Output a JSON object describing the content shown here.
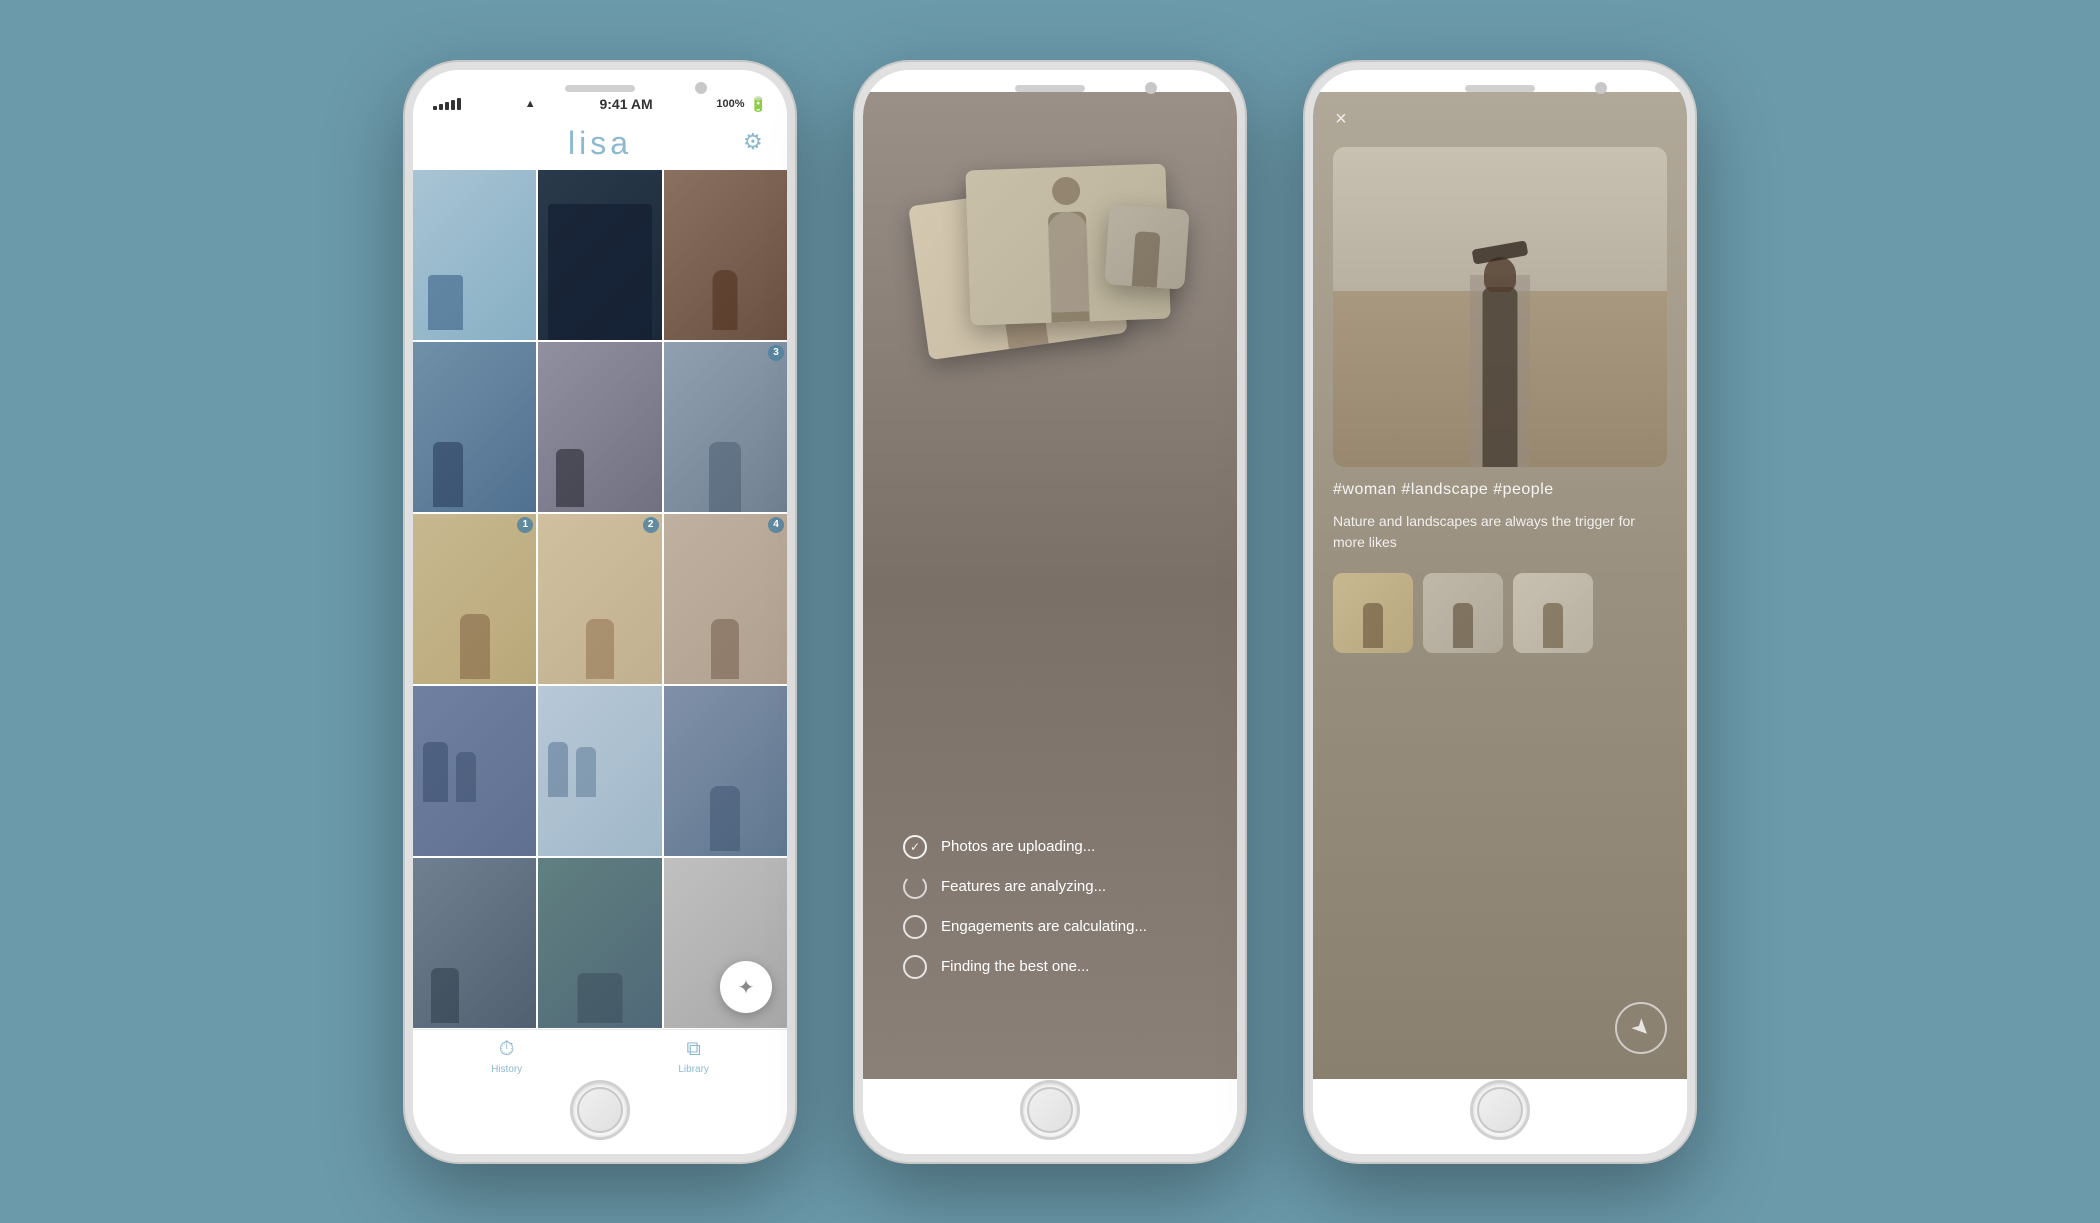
{
  "background": "#6b9aab",
  "phones": [
    {
      "id": "phone1",
      "status_bar": {
        "signal": "●●●●●",
        "wifi": "WiFi",
        "time": "9:41 AM",
        "battery": "100%"
      },
      "header": {
        "title": "lisa",
        "settings_icon": "⚙"
      },
      "grid": {
        "cells": [
          {
            "color_class": "pc1",
            "badge": null
          },
          {
            "color_class": "pc2",
            "badge": null
          },
          {
            "color_class": "pc3",
            "badge": null
          },
          {
            "color_class": "pc4",
            "badge": null
          },
          {
            "color_class": "pc5",
            "badge": null
          },
          {
            "color_class": "pc6",
            "badge": "3"
          },
          {
            "color_class": "pc7",
            "badge": "1"
          },
          {
            "color_class": "pc8",
            "badge": "2"
          },
          {
            "color_class": "pc9",
            "badge": "4"
          },
          {
            "color_class": "pc10",
            "badge": null
          },
          {
            "color_class": "pc11",
            "badge": null
          },
          {
            "color_class": "pc12",
            "badge": null
          },
          {
            "color_class": "pc13",
            "badge": null
          },
          {
            "color_class": "pc14",
            "badge": null
          },
          {
            "color_class": "pc15",
            "badge": null
          }
        ]
      },
      "magic_wand": "✦",
      "nav": {
        "items": [
          {
            "icon": "⏱",
            "label": "History"
          },
          {
            "icon": "⧉",
            "label": "Library"
          }
        ]
      }
    },
    {
      "id": "phone2",
      "status_items": [
        {
          "text": "Photos are uploading...",
          "done": true
        },
        {
          "text": "Features are analyzing...",
          "done": false
        },
        {
          "text": "Engagements are calculating...",
          "done": false
        },
        {
          "text": "Finding the best one...",
          "done": false
        }
      ]
    },
    {
      "id": "phone3",
      "close_icon": "×",
      "hashtags": "#woman #landscape #people",
      "caption": "Nature and landscapes are always the trigger for more likes",
      "share_icon": "➤",
      "thumbnails": [
        "thumb1",
        "thumb2",
        "thumb3"
      ]
    }
  ]
}
